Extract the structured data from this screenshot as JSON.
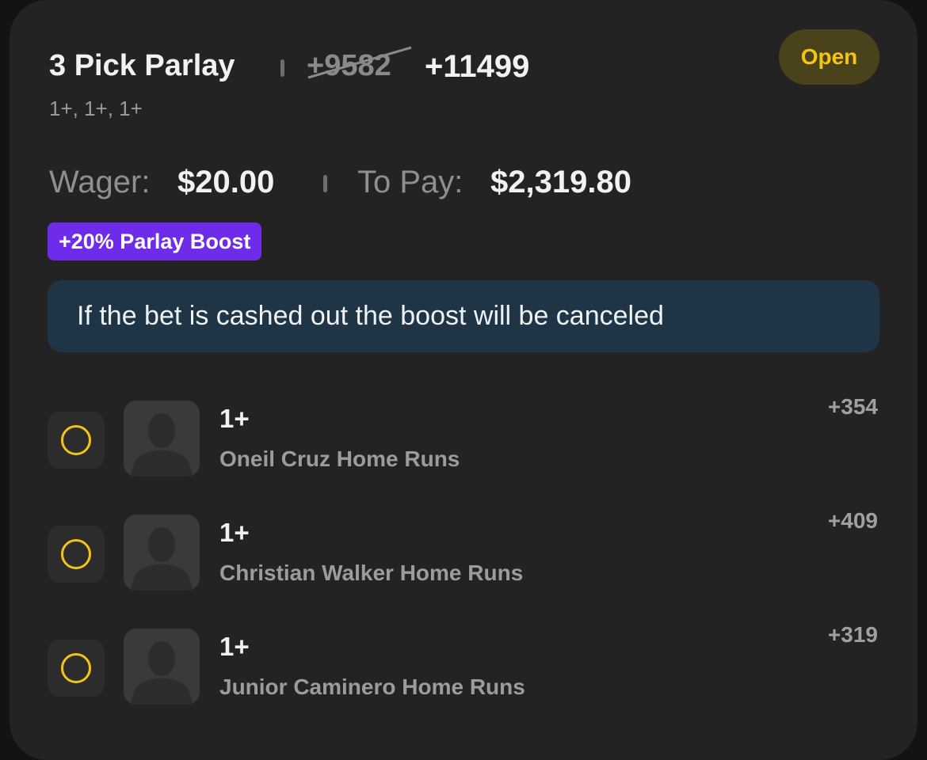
{
  "bet": {
    "title": "3 Pick Parlay",
    "original_odds": "+9582",
    "boosted_odds": "+11499",
    "subtitle": "1+, 1+, 1+",
    "status": "Open"
  },
  "wager": {
    "wager_label": "Wager:",
    "wager_value": "$20.00",
    "topay_label": "To Pay:",
    "topay_value": "$2,319.80"
  },
  "boost": {
    "label": "+20% Parlay Boost"
  },
  "notice": {
    "text": "If the bet is cashed out the boost will be canceled"
  },
  "picks": [
    {
      "line": "1+",
      "market": "Oneil Cruz Home Runs",
      "odds": "+354"
    },
    {
      "line": "1+",
      "market": "Christian Walker Home Runs",
      "odds": "+409"
    },
    {
      "line": "1+",
      "market": "Junior Caminero Home Runs",
      "odds": "+319"
    }
  ],
  "colors": {
    "background": "#232323",
    "status_text": "#f3c518",
    "status_bg": "#4a421a",
    "boost_bg": "#6f2bea",
    "notice_bg": "#1f3444"
  },
  "icons": {
    "pick_status": "pending-circle-icon",
    "avatar": "player-silhouette-icon"
  }
}
